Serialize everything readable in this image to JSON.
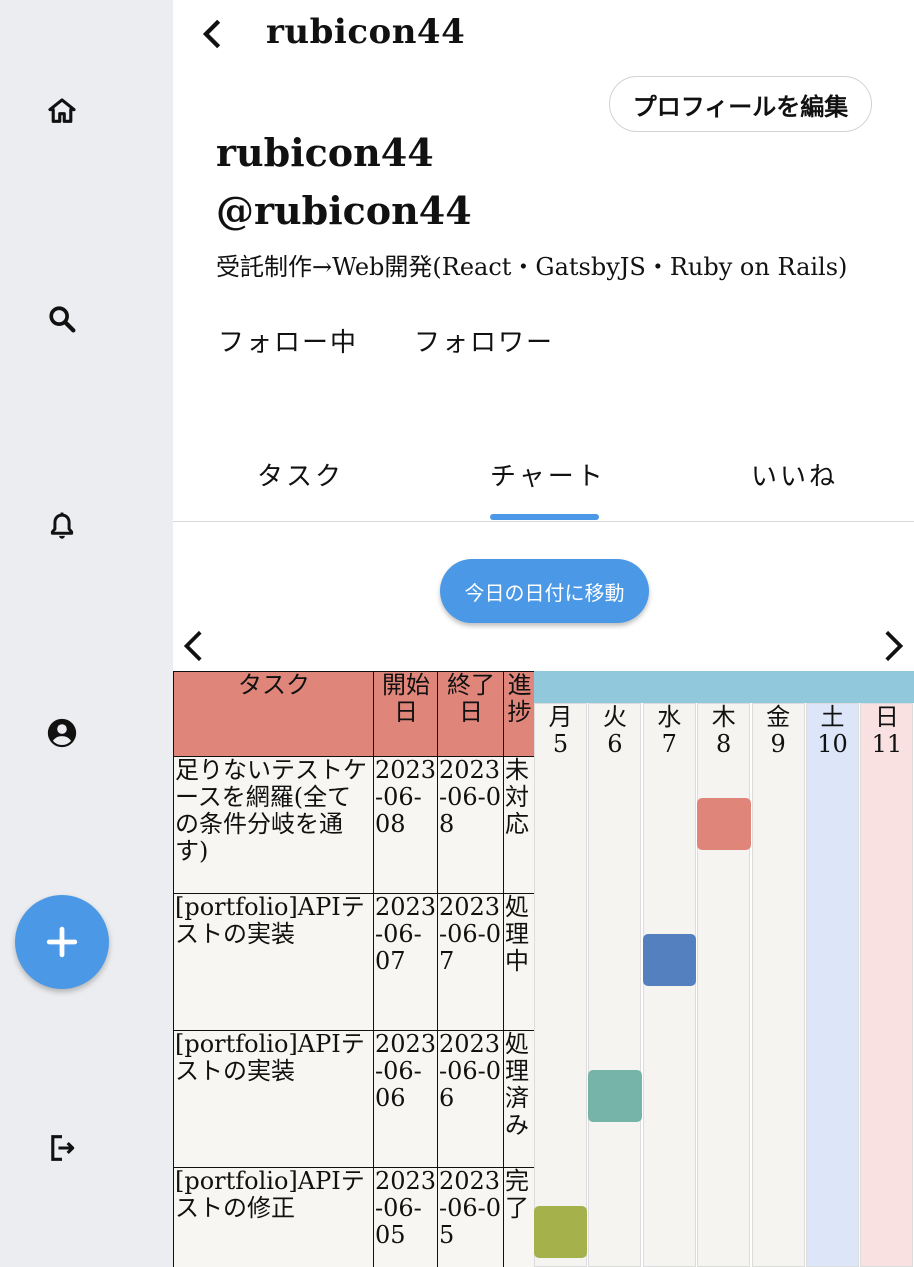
{
  "header": {
    "title": "rubicon44",
    "back_icon": "chevron-left-icon"
  },
  "profile": {
    "edit_label": "プロフィールを編集",
    "name": "rubicon44",
    "handle": "@rubicon44",
    "bio": "受託制作→Web開発(React・GatsbyJS・Ruby on Rails)",
    "following_label": "フォロー中",
    "followers_label": "フォロワー"
  },
  "sidebar": {
    "items": [
      {
        "name": "home",
        "icon": "home-icon"
      },
      {
        "name": "search",
        "icon": "search-icon"
      },
      {
        "name": "notifications",
        "icon": "bell-icon"
      },
      {
        "name": "profile",
        "icon": "account-circle-icon"
      },
      {
        "name": "logout",
        "icon": "logout-icon"
      }
    ],
    "fab_icon": "plus-icon"
  },
  "tabs": [
    {
      "label": "タスク",
      "active": false
    },
    {
      "label": "チャート",
      "active": true
    },
    {
      "label": "いいね",
      "active": false
    }
  ],
  "chart": {
    "today_button": "今日の日付に移動",
    "columns": {
      "task": "タスク",
      "start": "開始日",
      "end": "終了日",
      "status": "進捗"
    },
    "days": [
      {
        "weekday": "月",
        "day": "5"
      },
      {
        "weekday": "火",
        "day": "6"
      },
      {
        "weekday": "水",
        "day": "7"
      },
      {
        "weekday": "木",
        "day": "8"
      },
      {
        "weekday": "金",
        "day": "9"
      },
      {
        "weekday": "土",
        "day": "10"
      },
      {
        "weekday": "日",
        "day": "11"
      }
    ],
    "tasks": [
      {
        "title": "足りないテストケースを網羅(全ての条件分岐を通す)",
        "start": "2023-06-08",
        "end": "2023-06-08",
        "status": "未対応",
        "color": "#e0857a"
      },
      {
        "title": "[portfolio]APIテストの実装",
        "start": "2023-06-07",
        "end": "2023-06-07",
        "status": "処理中",
        "color": "#5580c0"
      },
      {
        "title": "[portfolio]APIテストの実装",
        "start": "2023-06-06",
        "end": "2023-06-06",
        "status": "処理済み",
        "color": "#76b3a8"
      },
      {
        "title": "[portfolio]APIテストの修正",
        "start": "2023-06-05",
        "end": "2023-06-05",
        "status": "完了",
        "color": "#a5b24b"
      }
    ]
  },
  "colors": {
    "accent": "#4a98e6",
    "table_header": "#e0857a",
    "timeline_header": "#92c8dc",
    "saturday": "#dce6f8",
    "sunday": "#f8e1e0"
  }
}
